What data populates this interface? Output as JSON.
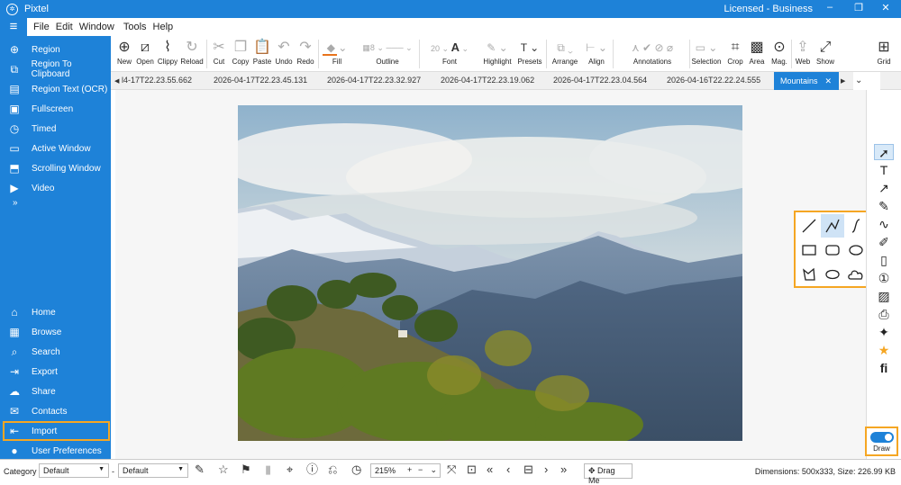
{
  "app": {
    "title": "Pixtel",
    "license": "Licensed - Business"
  },
  "window": {
    "minimize": "‒",
    "restore": "❐",
    "close": "✕"
  },
  "menu": [
    "File",
    "Edit",
    "Window",
    "Tools",
    "Help"
  ],
  "sidebar": {
    "capture": [
      {
        "label": "Region",
        "icon": "region-icon"
      },
      {
        "label": "Region To Clipboard",
        "icon": "clipboard-icon"
      },
      {
        "label": "Region Text (OCR)",
        "icon": "ocr-icon"
      },
      {
        "label": "Fullscreen",
        "icon": "fullscreen-icon"
      },
      {
        "label": "Timed",
        "icon": "timer-icon"
      },
      {
        "label": "Active Window",
        "icon": "window-icon"
      },
      {
        "label": "Scrolling Window",
        "icon": "scroll-icon"
      },
      {
        "label": "Video",
        "icon": "video-icon"
      }
    ],
    "more": "»",
    "nav": [
      {
        "label": "Home",
        "icon": "home-icon"
      },
      {
        "label": "Browse",
        "icon": "browse-icon"
      },
      {
        "label": "Search",
        "icon": "search-icon"
      },
      {
        "label": "Export",
        "icon": "export-icon"
      },
      {
        "label": "Share",
        "icon": "share-icon"
      },
      {
        "label": "Contacts",
        "icon": "contacts-icon"
      },
      {
        "label": "Import",
        "icon": "import-icon"
      },
      {
        "label": "User Preferences",
        "icon": "user-icon"
      }
    ]
  },
  "toolbar": {
    "new": "New",
    "open": "Open",
    "clippy": "Clippy",
    "reload": "Reload",
    "cut": "Cut",
    "copy": "Copy",
    "paste": "Paste",
    "undo": "Undo",
    "redo": "Redo",
    "fill": "Fill",
    "outline": "Outline",
    "outline_width": "8",
    "font": "Font",
    "font_size": "20",
    "highlight": "Highlight",
    "presets": "Presets",
    "arrange": "Arrange",
    "align": "Align",
    "annotations": "Annotations",
    "selection": "Selection",
    "crop": "Crop",
    "area": "Area",
    "mag": "Mag.",
    "web": "Web",
    "show": "Show",
    "grid": "Grid"
  },
  "tabs": [
    "l4-17T22.23.55.662",
    "2026-04-17T22.23.45.131",
    "2026-04-17T22.23.32.927",
    "2026-04-17T22.23.19.062",
    "2026-04-17T22.23.04.564",
    "2026-04-16T22.22.24.555"
  ],
  "active_tab": "Mountains",
  "draw": {
    "label": "Draw",
    "on": true
  },
  "status": {
    "category_label": "Category",
    "category_value": "Default",
    "second_value": "Default",
    "zoom": "215%",
    "drag": "Drag Me",
    "info": "Dimensions: 500x333, Size: 226.99 KB"
  },
  "colors": {
    "accent": "#1e82d8",
    "highlight_box": "#f5a623",
    "fill_swatch": "#e8731c",
    "font_swatch": "#2e9e3a",
    "highlight_swatch": "#e040fb"
  }
}
